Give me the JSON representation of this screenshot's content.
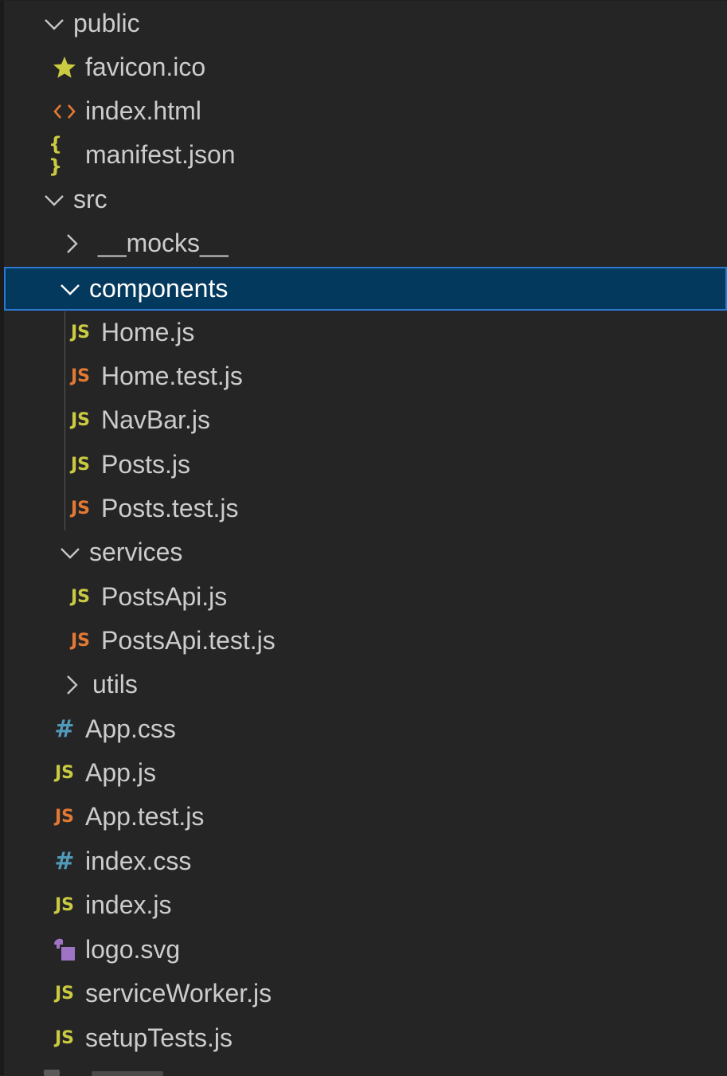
{
  "explorer": {
    "public": {
      "label": "public",
      "files": [
        {
          "label": "favicon.ico",
          "icon": "star-icon"
        },
        {
          "label": "index.html",
          "icon": "html-icon"
        },
        {
          "label": "manifest.json",
          "icon": "json-icon"
        }
      ]
    },
    "src": {
      "label": "src",
      "mocks": {
        "label": "__mocks__"
      },
      "components": {
        "label": "components",
        "files": [
          {
            "label": "Home.js",
            "icon": "js-icon"
          },
          {
            "label": "Home.test.js",
            "icon": "js-test-icon"
          },
          {
            "label": "NavBar.js",
            "icon": "js-icon"
          },
          {
            "label": "Posts.js",
            "icon": "js-icon"
          },
          {
            "label": "Posts.test.js",
            "icon": "js-test-icon"
          }
        ]
      },
      "services": {
        "label": "services",
        "files": [
          {
            "label": "PostsApi.js",
            "icon": "js-icon"
          },
          {
            "label": "PostsApi.test.js",
            "icon": "js-test-icon"
          }
        ]
      },
      "utils": {
        "label": "utils"
      },
      "files": [
        {
          "label": "App.css",
          "icon": "css-icon"
        },
        {
          "label": "App.js",
          "icon": "js-icon"
        },
        {
          "label": "App.test.js",
          "icon": "js-test-icon"
        },
        {
          "label": "index.css",
          "icon": "css-icon"
        },
        {
          "label": "index.js",
          "icon": "js-icon"
        },
        {
          "label": "logo.svg",
          "icon": "svg-icon"
        },
        {
          "label": "serviceWorker.js",
          "icon": "js-icon"
        },
        {
          "label": "setupTests.js",
          "icon": "js-icon"
        }
      ]
    },
    "icon_glyphs": {
      "js": "JS",
      "hash": "#",
      "json": "{ }",
      "html": "<>"
    }
  },
  "colors": {
    "background": "#252526",
    "selected_background": "#04395e",
    "selected_border": "#2b79d0",
    "js_yellow": "#cbcb41",
    "js_test_orange": "#e37933",
    "css_blue": "#519aba",
    "svg_purple": "#a074c4",
    "text": "#cccccc"
  }
}
